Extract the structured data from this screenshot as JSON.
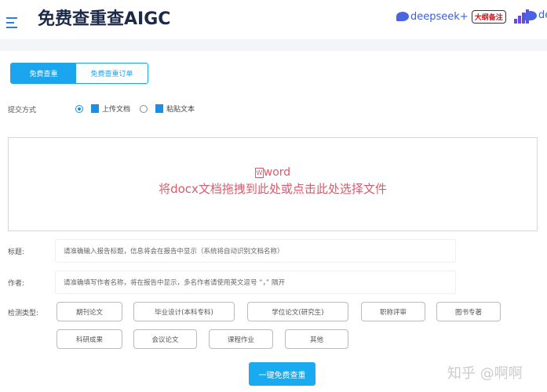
{
  "header": {
    "title": "免费查重查AIGC",
    "brand1": "deepseek+",
    "badge": "大纲备注",
    "brand2": "de"
  },
  "tabs": [
    "免费查重",
    "免费查重订单"
  ],
  "submit_method": {
    "label": "提交方式",
    "options": [
      "上传文档",
      "粘贴文本"
    ],
    "selected": 0
  },
  "dropzone": {
    "type": "word",
    "message": "将docx文档拖拽到此处或点击此处选择文件"
  },
  "title_field": {
    "label": "标题:",
    "placeholder": "请准确输入报告标题，信息将会在报告中显示（系统将自动识别文档名称）"
  },
  "author_field": {
    "label": "作者:",
    "placeholder": "请准确填写作者名称，将在报告中显示，多名作者请使用英文逗号 “，” 隔开"
  },
  "check_type": {
    "label": "检测类型:",
    "options": [
      "期刊论文",
      "毕业设计(本科专科)",
      "学位论文(研究生)",
      "职称评审",
      "图书专著",
      "科研成果",
      "会议论文",
      "课程作业",
      "其他"
    ]
  },
  "submit_label": "一键免费查重",
  "watermark": "知乎 @啊啊",
  "colors": {
    "accent": "#19aaf0",
    "drop_text": "#d95c6c"
  }
}
